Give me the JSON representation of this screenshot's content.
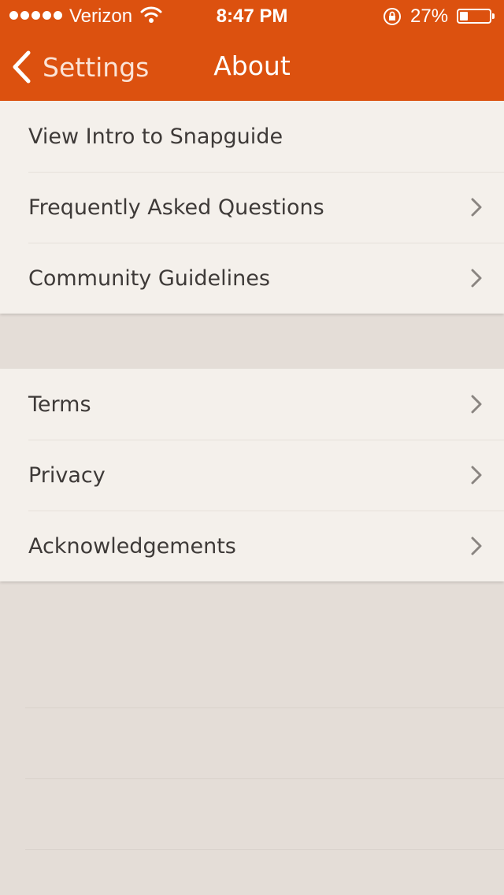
{
  "status_bar": {
    "carrier": "Verizon",
    "time": "8:47 PM",
    "battery_percent": "27%",
    "battery_level": 0.27
  },
  "nav": {
    "back_label": "Settings",
    "title": "About"
  },
  "groups": [
    {
      "items": [
        {
          "label": "View Intro to Snapguide",
          "has_chevron": false
        },
        {
          "label": "Frequently Asked Questions",
          "has_chevron": true
        },
        {
          "label": "Community Guidelines",
          "has_chevron": true
        }
      ]
    },
    {
      "items": [
        {
          "label": "Terms",
          "has_chevron": true
        },
        {
          "label": "Privacy",
          "has_chevron": true
        },
        {
          "label": "Acknowledgements",
          "has_chevron": true
        }
      ]
    }
  ],
  "colors": {
    "accent": "#dc510f",
    "row_background": "#f4f0eb",
    "page_background": "#e4ddd7",
    "text": "#3e3a38"
  },
  "icons": [
    "signal-dots-icon",
    "wifi-icon",
    "rotation-lock-icon",
    "battery-icon",
    "back-chevron-icon",
    "chevron-right-icon"
  ]
}
